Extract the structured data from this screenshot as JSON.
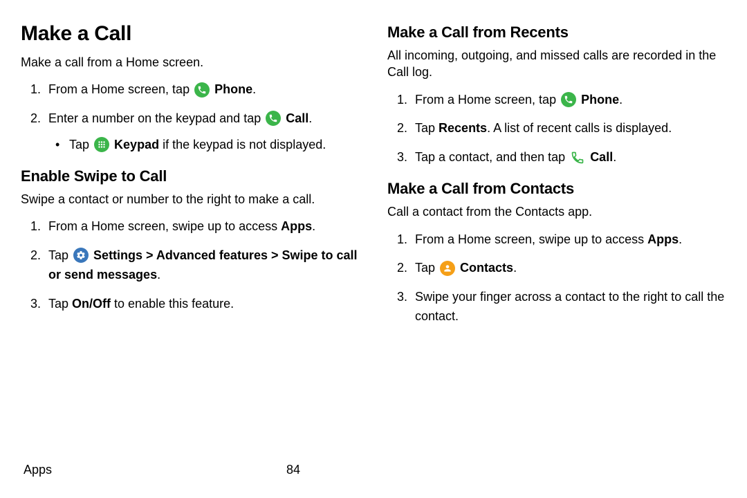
{
  "left": {
    "h1": "Make a Call",
    "intro": "Make a call from a Home screen.",
    "s1_pre": "From a Home screen, tap ",
    "s1_bold": "Phone",
    "s1_post": ".",
    "s2_pre": "Enter a number on the keypad and tap ",
    "s2_bold": "Call",
    "s2_post": ".",
    "s2b_pre": "Tap ",
    "s2b_bold": "Keypad",
    "s2b_post": " if the keypad is not displayed.",
    "h2": "Enable Swipe to Call",
    "intro2": "Swipe a contact or number to the right to make a call.",
    "e1_pre": "From a Home screen, swipe up to access ",
    "e1_bold": "Apps",
    "e1_post": ".",
    "e2_pre": "Tap ",
    "e2_bold": "Settings > Advanced features > Swipe to call or send messages",
    "e2_post": ".",
    "e3_pre": "Tap ",
    "e3_bold": "On/Off",
    "e3_post": " to enable this feature."
  },
  "right": {
    "h2a": "Make a Call from Recents",
    "introa": "All incoming, outgoing, and missed calls are recorded in the Call log.",
    "a1_pre": "From a Home screen, tap ",
    "a1_bold": "Phone",
    "a1_post": ".",
    "a2_pre": "Tap ",
    "a2_bold": "Recents",
    "a2_post": ". A list of recent calls is displayed.",
    "a3_pre": "Tap a contact, and then tap ",
    "a3_bold": "Call",
    "a3_post": ".",
    "h2b": "Make a Call from Contacts",
    "introb": "Call a contact from the Contacts app.",
    "b1_pre": "From a Home screen, swipe up to access ",
    "b1_bold": "Apps",
    "b1_post": ".",
    "b2_pre": "Tap ",
    "b2_bold": "Contacts",
    "b2_post": ".",
    "b3": "Swipe your finger across a contact to the right to call the contact."
  },
  "footer": {
    "section": "Apps",
    "page": "84"
  }
}
